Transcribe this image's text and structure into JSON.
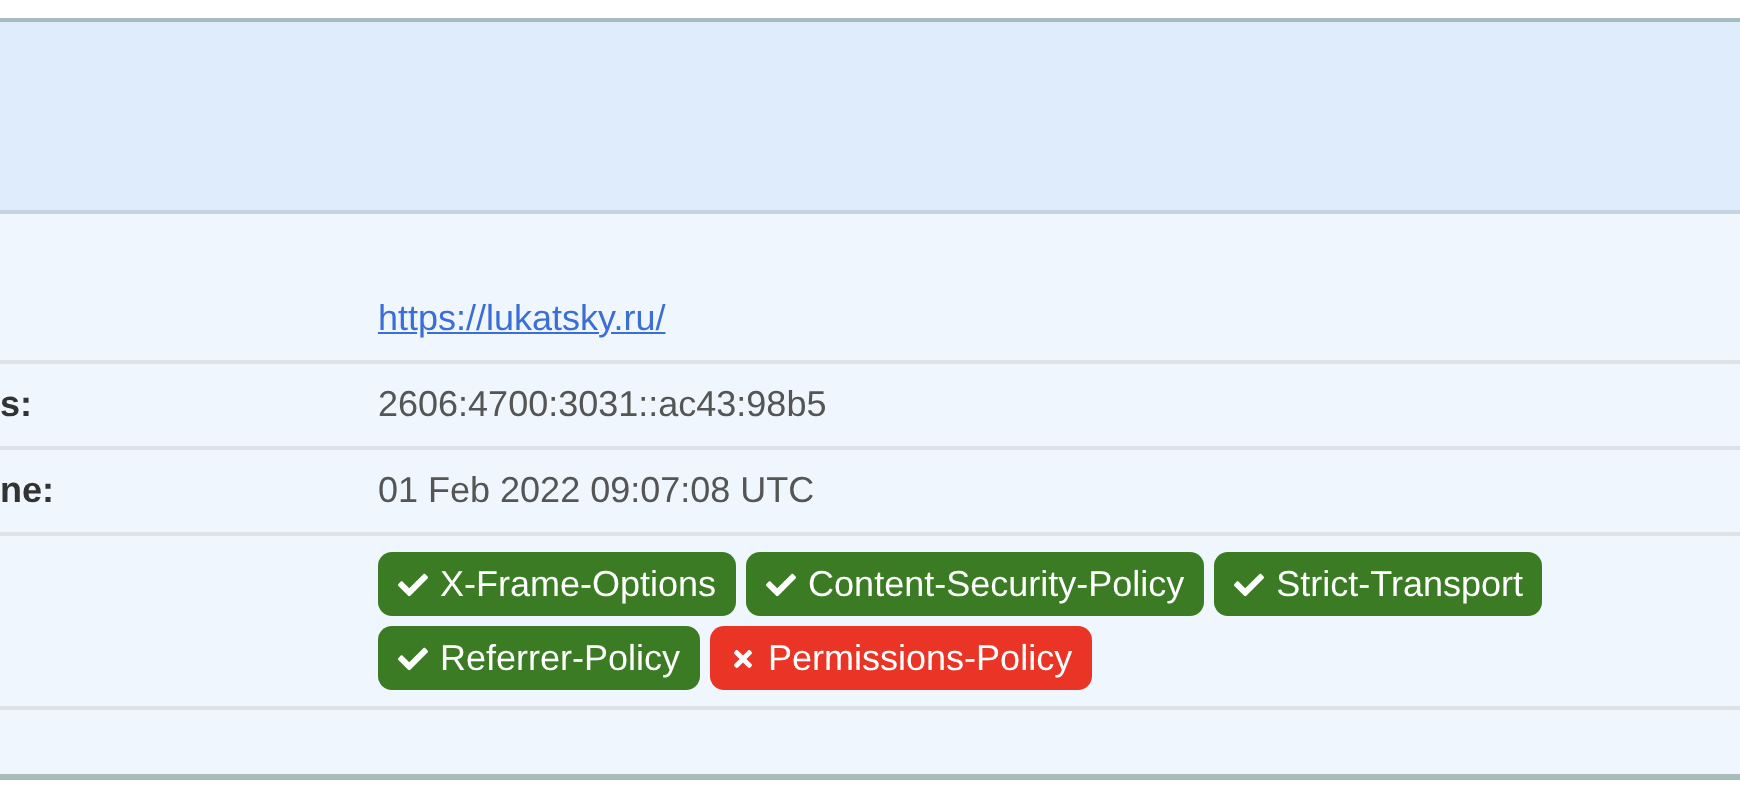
{
  "rows": [
    {
      "kind": "link",
      "value": "https://lukatsky.ru/"
    },
    {
      "kind": "text",
      "label": "s:",
      "value": "2606:4700:3031::ac43:98b5"
    },
    {
      "kind": "text",
      "label": "ne:",
      "value": "01 Feb 2022 09:07:08 UTC"
    },
    {
      "kind": "badges",
      "badges": [
        {
          "label": "X-Frame-Options",
          "passed": true
        },
        {
          "label": "Content-Security-Policy",
          "passed": true
        },
        {
          "label": "Strict-Transport",
          "passed": true
        },
        {
          "label": "Referrer-Policy",
          "passed": true
        },
        {
          "label": "Permissions-Policy",
          "passed": false
        }
      ]
    }
  ]
}
